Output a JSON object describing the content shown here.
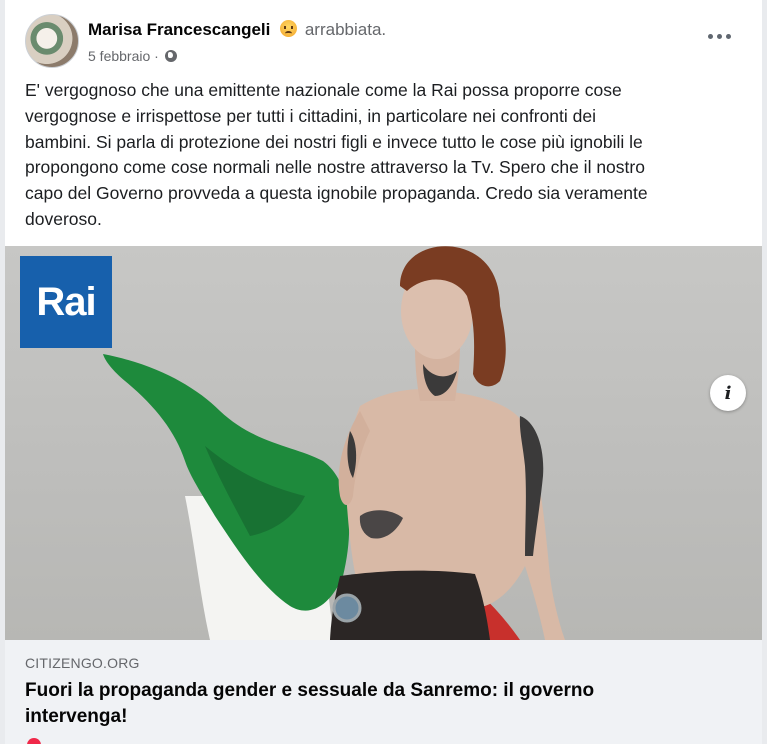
{
  "post": {
    "author": "Marisa Francescangeli",
    "feeling_icon": "angry-face-emoji",
    "feeling": "arrabbiata.",
    "date": "5 febbraio",
    "separator": "·",
    "privacy_icon": "globe-icon",
    "text_lines": [
      "E' vergognoso che una emittente nazionale come la Rai possa proporre cose",
      "vergognose e irrispettose per tutti i cittadini, in particolare nei confronti dei",
      "bambini. Si parla di protezione dei nostri figli e invece tutto le cose più ignobili le",
      "propongono come cose normali nelle nostre attraverso la Tv. Spero che il nostro",
      "capo del Governo provveda a questa ignobile propaganda. Credo sia veramente",
      "doveroso."
    ]
  },
  "media": {
    "logo_text": "Rai",
    "logo_color": "#1760ac",
    "info_label": "i"
  },
  "link": {
    "domain": "CITIZENGO.ORG",
    "title_lines": [
      "Fuori la propaganda gender e sessuale da Sanremo: il governo",
      "intervenga!"
    ]
  },
  "colors": {
    "flag_green": "#1e8a3c",
    "flag_white": "#f4f4f2",
    "flag_red": "#c8302c",
    "secondary_text": "#65676b"
  }
}
